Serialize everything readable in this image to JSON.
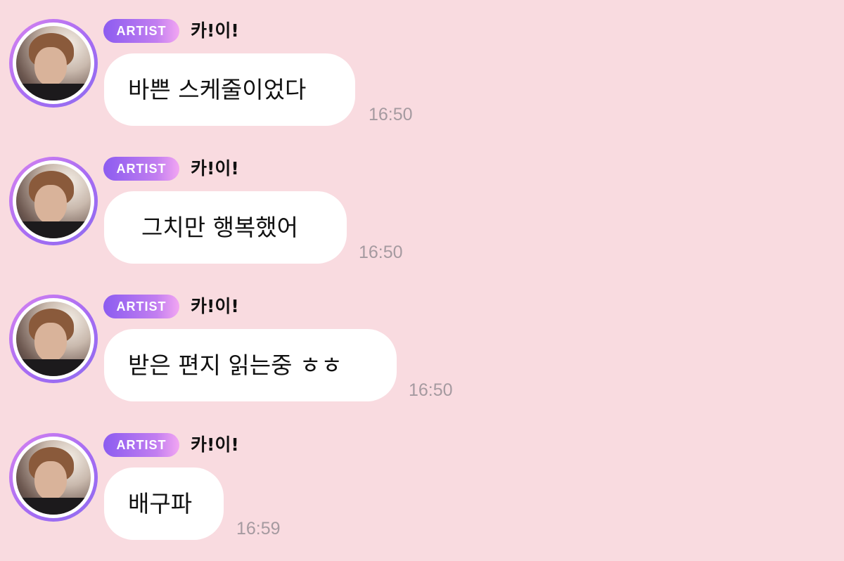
{
  "chat": {
    "messages": [
      {
        "badge": "ARTIST",
        "sender": "카!이!",
        "avatar": "avatar-photo-icon",
        "text": "바쁜 스케줄이었다",
        "time": "16:50"
      },
      {
        "badge": "ARTIST",
        "sender": "카!이!",
        "avatar": "avatar-photo-icon",
        "text": "그치만 행복했어",
        "time": "16:50"
      },
      {
        "badge": "ARTIST",
        "sender": "카!이!",
        "avatar": "avatar-photo-icon",
        "text": "받은 편지 읽는중 ㅎㅎ",
        "time": "16:50"
      },
      {
        "badge": "ARTIST",
        "sender": "카!이!",
        "avatar": "avatar-photo-icon",
        "text": "배구파",
        "time": "16:59"
      }
    ]
  },
  "colors": {
    "background": "#f9dbe0",
    "bubble": "#ffffff",
    "badge_start": "#8c5cf0",
    "badge_end": "#f2a6f2",
    "avatar_ring": "#a66cf3",
    "timestamp": "#a59aa0",
    "text": "#111111"
  }
}
